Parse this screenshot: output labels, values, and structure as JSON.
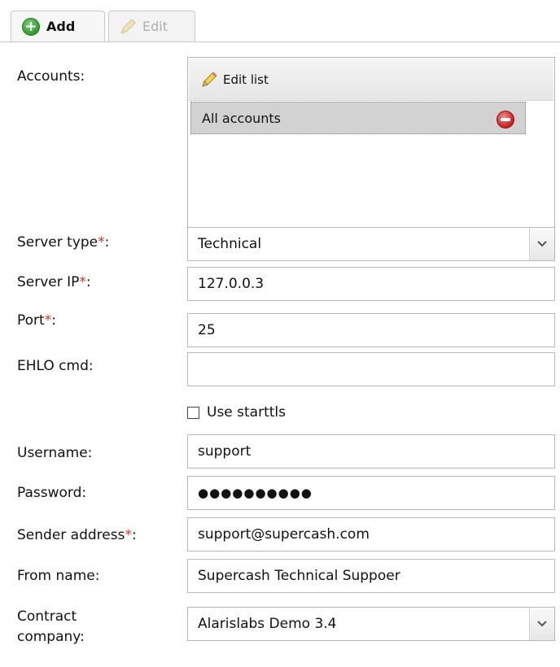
{
  "tabs": {
    "add_label": "Add",
    "edit_label": "Edit"
  },
  "accounts": {
    "label": "Accounts:",
    "edit_list_label": "Edit list",
    "items": [
      "All accounts"
    ]
  },
  "form": {
    "server_type": {
      "label": "Server type",
      "value": "Technical"
    },
    "server_ip": {
      "label": "Server IP",
      "value": "127.0.0.3"
    },
    "port": {
      "label": "Port",
      "value": "25"
    },
    "ehlo": {
      "label": "EHLO cmd:",
      "value": ""
    },
    "starttls": {
      "label": "Use starttls",
      "checked": false
    },
    "username": {
      "label": "Username:",
      "value": "support"
    },
    "password": {
      "label": "Password:",
      "value": "●●●●●●●●●●"
    },
    "sender": {
      "label": "Sender address",
      "value": "support@supercash.com"
    },
    "from_name": {
      "label": "From name:",
      "value": "Supercash Technical Suppoer"
    },
    "contract_company": {
      "label_line1": "Contract",
      "label_line2": "company:",
      "value": "Alarislabs Demo 3.4"
    },
    "required_mark": "*",
    "colon": ":"
  },
  "colors": {
    "required": "#e03030",
    "selected_row": "#d2d2d2"
  }
}
